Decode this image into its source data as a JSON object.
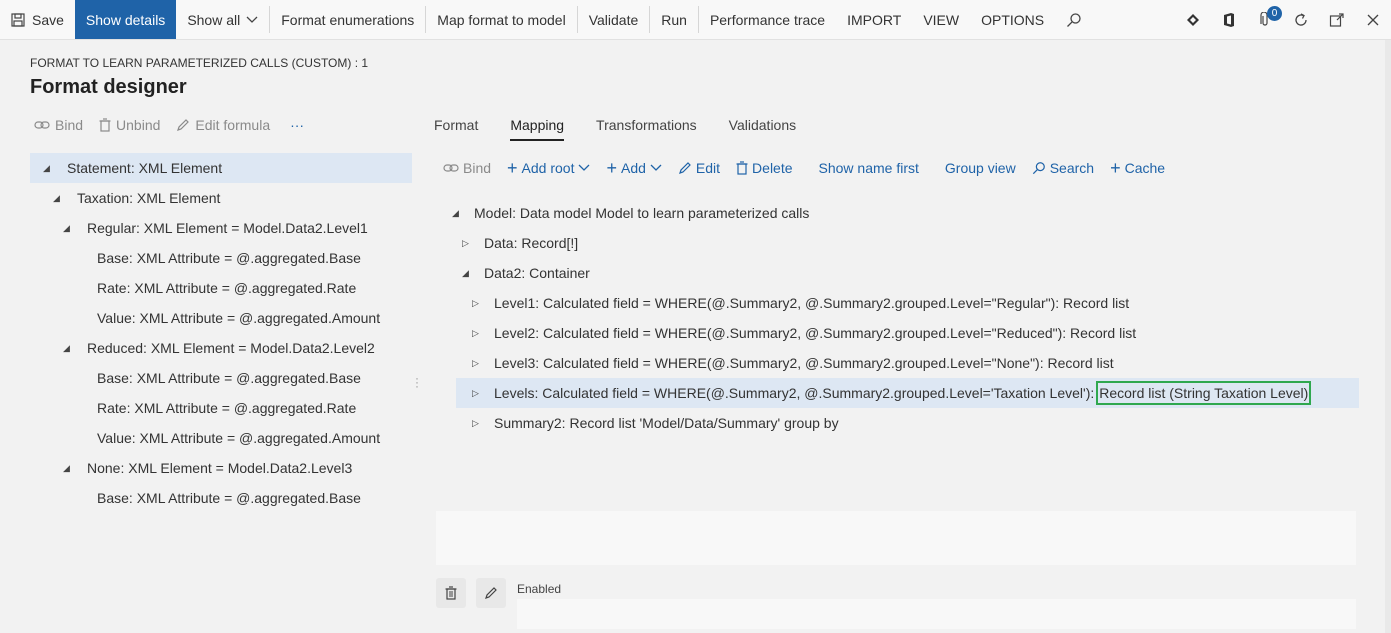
{
  "toolbar": {
    "save": "Save",
    "show_details": "Show details",
    "show_all": "Show all",
    "format_enumerations": "Format enumerations",
    "map_format_to_model": "Map format to model",
    "validate": "Validate",
    "run": "Run",
    "performance_trace": "Performance trace",
    "import": "IMPORT",
    "view": "VIEW",
    "options": "OPTIONS",
    "notification_count": "0"
  },
  "header": {
    "breadcrumb": "FORMAT TO LEARN PARAMETERIZED CALLS (CUSTOM) : 1",
    "title": "Format designer"
  },
  "left_actions": {
    "bind": "Bind",
    "unbind": "Unbind",
    "edit_formula": "Edit formula",
    "more": "···"
  },
  "format_tree": [
    {
      "label": "Statement: XML Element",
      "expanded": true,
      "selected": true
    },
    {
      "label": "Taxation: XML Element",
      "expanded": true
    },
    {
      "label": "Regular: XML Element = Model.Data2.Level1",
      "expanded": true
    },
    {
      "label": "Base: XML Attribute = @.aggregated.Base"
    },
    {
      "label": "Rate: XML Attribute = @.aggregated.Rate"
    },
    {
      "label": "Value: XML Attribute = @.aggregated.Amount"
    },
    {
      "label": "Reduced: XML Element = Model.Data2.Level2",
      "expanded": true
    },
    {
      "label": "Base: XML Attribute = @.aggregated.Base"
    },
    {
      "label": "Rate: XML Attribute = @.aggregated.Rate"
    },
    {
      "label": "Value: XML Attribute = @.aggregated.Amount"
    },
    {
      "label": "None: XML Element = Model.Data2.Level3",
      "expanded": true
    },
    {
      "label": "Base: XML Attribute = @.aggregated.Base"
    }
  ],
  "tabs": [
    "Format",
    "Mapping",
    "Transformations",
    "Validations"
  ],
  "active_tab": "Mapping",
  "right_actions": {
    "bind": "Bind",
    "add_root": "Add root",
    "add": "Add",
    "edit": "Edit",
    "delete": "Delete",
    "show_name_first": "Show name first",
    "group_view": "Group view",
    "search": "Search",
    "cache": "Cache"
  },
  "model_tree": [
    {
      "label": "Model: Data model Model to learn parameterized calls",
      "expanded": true
    },
    {
      "label": "Data: Record[!]",
      "expanded": false
    },
    {
      "label": "Data2: Container",
      "expanded": true
    },
    {
      "label": "Level1: Calculated field = WHERE(@.Summary2, @.Summary2.grouped.Level=\"Regular\"): Record list",
      "expanded": false
    },
    {
      "label": "Level2: Calculated field = WHERE(@.Summary2, @.Summary2.grouped.Level=\"Reduced\"): Record list",
      "expanded": false
    },
    {
      "label": "Level3: Calculated field = WHERE(@.Summary2, @.Summary2.grouped.Level=\"None\"): Record list",
      "expanded": false
    },
    {
      "label": "Levels: Calculated field = WHERE(@.Summary2, @.Summary2.grouped.Level='Taxation Level'):",
      "highlight": "Record list (String Taxation Level)",
      "expanded": false,
      "selected": true
    },
    {
      "label": "Summary2: Record list 'Model/Data/Summary' group by",
      "expanded": false
    }
  ],
  "footer": {
    "enabled_label": "Enabled"
  },
  "colors": {
    "accent": "#1f63a8",
    "selection": "#dde7f3",
    "highlight_border": "#2fa84f"
  }
}
